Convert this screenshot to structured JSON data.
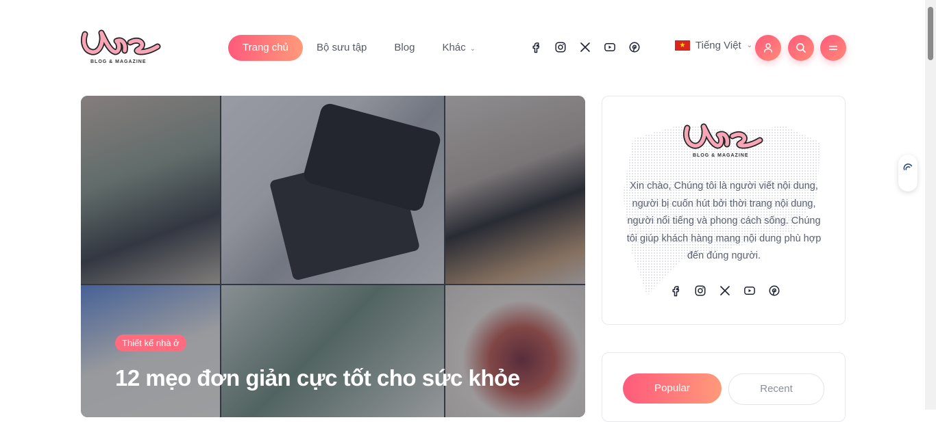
{
  "brand": {
    "name": "Vns",
    "tagline": "BLOG & MAGAZINE",
    "colors": {
      "accent": "#ff5a7b",
      "accent_end": "#ff9a7a",
      "logo_pink": "#f6a6b6"
    }
  },
  "nav": {
    "items": [
      {
        "label": "Trang chủ",
        "active": true
      },
      {
        "label": "Bộ sưu tập"
      },
      {
        "label": "Blog"
      },
      {
        "label": "Khác",
        "dropdown": true
      }
    ]
  },
  "social_icons": [
    "facebook-icon",
    "instagram-icon",
    "x-icon",
    "youtube-icon",
    "pinterest-icon"
  ],
  "language": {
    "label": "Tiếng Việt",
    "flag": "vietnam-flag"
  },
  "header_buttons": [
    "user-icon",
    "search-icon",
    "menu-icon"
  ],
  "hero": {
    "category": "Thiết kế nhà ở",
    "title": "12 mẹo đơn giản cực tốt cho sức khỏe"
  },
  "about": {
    "text": "Xin chào, Chúng tôi là người viết nội dung, người bị cuốn hút bởi thời trang nội dung, người nổi tiếng và phong cách sống. Chúng tôi giúp khách hàng mang nội dung phù hợp đến đúng người."
  },
  "tabs": {
    "popular": "Popular",
    "recent": "Recent"
  }
}
